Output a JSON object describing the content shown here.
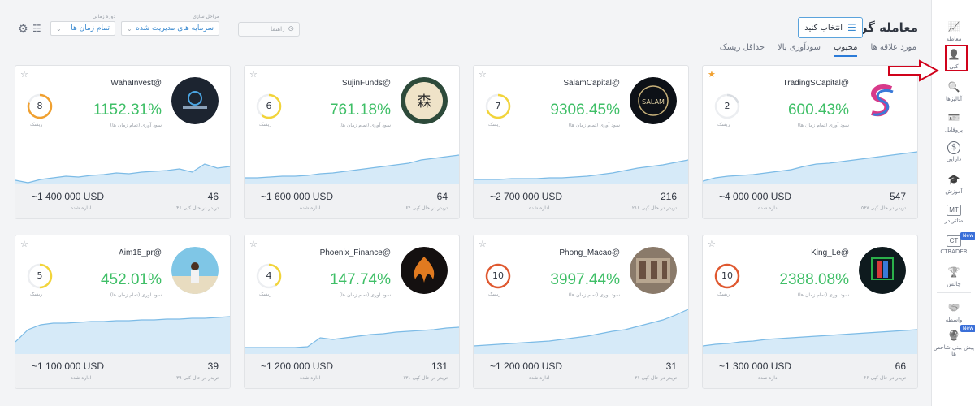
{
  "header": {
    "title": "معامله گران",
    "select_button": "انتخاب کنید",
    "tabs": [
      {
        "label": "مورد علاقه ها",
        "active": false
      },
      {
        "label": "محبوب",
        "active": true
      },
      {
        "label": "سودآوری بالا",
        "active": false
      },
      {
        "label": "حداقل ریسک",
        "active": false
      }
    ],
    "strategy_label": "مراحل سازی",
    "strategy_value": "سرمایه های مدیریت شده",
    "period_label": "دوره زمانی",
    "period_value": "تمام زمان ها",
    "search_placeholder": "راهنما"
  },
  "labels": {
    "return": "سود آوری (تمام زمان ها)",
    "risk": "ریسک",
    "aum": "اداره شده"
  },
  "cards": [
    {
      "handle": "WahaInvest@",
      "return": "1152.31%",
      "risk": "8",
      "risk_color": "#f0a030",
      "aum": "~1 400 000 USD",
      "investors": "46",
      "investors_label": "۴۶ تریدر در حال کپی",
      "favorite": false,
      "avatar": "waha",
      "spark": [
        55,
        58,
        54,
        52,
        50,
        51,
        49,
        48,
        46,
        47,
        45,
        44,
        43,
        41,
        45,
        35,
        40,
        38
      ]
    },
    {
      "handle": "SujinFunds@",
      "return": "761.18%",
      "risk": "6",
      "risk_color": "#f2d43a",
      "aum": "~1 600 000 USD",
      "investors": "64",
      "investors_label": "۶۴ تریدر در حال کپی",
      "favorite": false,
      "avatar": "sujin",
      "spark": [
        52,
        52,
        51,
        50,
        50,
        49,
        47,
        46,
        44,
        42,
        40,
        38,
        36,
        34,
        30,
        28,
        26,
        24
      ]
    },
    {
      "handle": "SalamCapital@",
      "return": "9306.45%",
      "risk": "7",
      "risk_color": "#f2d43a",
      "aum": "~2 700 000 USD",
      "investors": "216",
      "investors_label": "۲۱۶ تریدر در حال کپی",
      "favorite": false,
      "avatar": "salam",
      "spark": [
        54,
        54,
        54,
        53,
        53,
        53,
        52,
        52,
        51,
        50,
        48,
        46,
        43,
        40,
        38,
        36,
        33,
        30
      ]
    },
    {
      "handle": "TradingSCapital@",
      "return": "600.43%",
      "risk": "2",
      "risk_color": "#d9dde2",
      "aum": "~4 000 000 USD",
      "investors": "547",
      "investors_label": "۵۴۷ تریدر در حال کپی",
      "favorite": true,
      "avatar": "tsc",
      "spark": [
        56,
        52,
        50,
        49,
        48,
        46,
        44,
        42,
        38,
        35,
        34,
        32,
        30,
        28,
        26,
        24,
        22,
        20
      ]
    },
    {
      "handle": "Aim15_pr@",
      "return": "452.01%",
      "risk": "5",
      "risk_color": "#f2d43a",
      "aum": "~1 100 000 USD",
      "investors": "39",
      "investors_label": "۳۹ تریدر در حال کپی",
      "favorite": false,
      "avatar": "aim",
      "spark": [
        45,
        30,
        24,
        22,
        22,
        21,
        20,
        20,
        19,
        19,
        18,
        18,
        17,
        17,
        16,
        16,
        15,
        14
      ]
    },
    {
      "handle": "Phoenix_Finance@",
      "return": "147.74%",
      "risk": "4",
      "risk_color": "#f2d43a",
      "aum": "~1 200 000 USD",
      "investors": "131",
      "investors_label": "۱۳۱ تریدر در حال کپی",
      "favorite": false,
      "avatar": "phoenix",
      "spark": [
        52,
        52,
        52,
        52,
        52,
        51,
        40,
        42,
        40,
        38,
        36,
        35,
        33,
        32,
        31,
        30,
        28,
        27
      ]
    },
    {
      "handle": "Phong_Macao@",
      "return": "3997.44%",
      "risk": "10",
      "risk_color": "#e0582f",
      "aum": "~1 200 000 USD",
      "investors": "31",
      "investors_label": "۳۱ تریدر در حال کپی",
      "favorite": false,
      "avatar": "phong",
      "spark": [
        50,
        49,
        48,
        47,
        46,
        45,
        44,
        42,
        40,
        38,
        35,
        32,
        30,
        26,
        22,
        18,
        12,
        5
      ]
    },
    {
      "handle": "King_Le@",
      "return": "2388.08%",
      "risk": "10",
      "risk_color": "#e0582f",
      "aum": "~1 300 000 USD",
      "investors": "66",
      "investors_label": "۶۶ تریدر در حال کپی",
      "favorite": false,
      "avatar": "king",
      "spark": [
        50,
        48,
        47,
        45,
        44,
        42,
        41,
        40,
        39,
        38,
        37,
        36,
        35,
        34,
        33,
        32,
        31,
        30
      ]
    }
  ],
  "sidebar": {
    "items": [
      {
        "label": "معامله",
        "icon": "chart-icon"
      },
      {
        "label": "کپی",
        "icon": "copy-user-icon",
        "active": true
      },
      {
        "label": "آنالیزها",
        "icon": "analysis-icon"
      },
      {
        "label": "پروفایل",
        "icon": "profile-icon"
      },
      {
        "label": "دارایی",
        "icon": "dollar-icon"
      },
      {
        "label": "آموزش",
        "icon": "education-icon"
      },
      {
        "label": "متاتریدر",
        "icon": "mt-icon",
        "icon_text": "MT"
      },
      {
        "label": "CTRADER",
        "icon": "ct-icon",
        "icon_text": "CT",
        "badge": "New"
      },
      {
        "label": "چالش",
        "icon": "challenge-icon"
      },
      {
        "label": "واسطه",
        "icon": "handshake-icon"
      },
      {
        "label": "پیش بینی شاخص ها",
        "icon": "prediction-icon",
        "badge": "New"
      }
    ]
  }
}
